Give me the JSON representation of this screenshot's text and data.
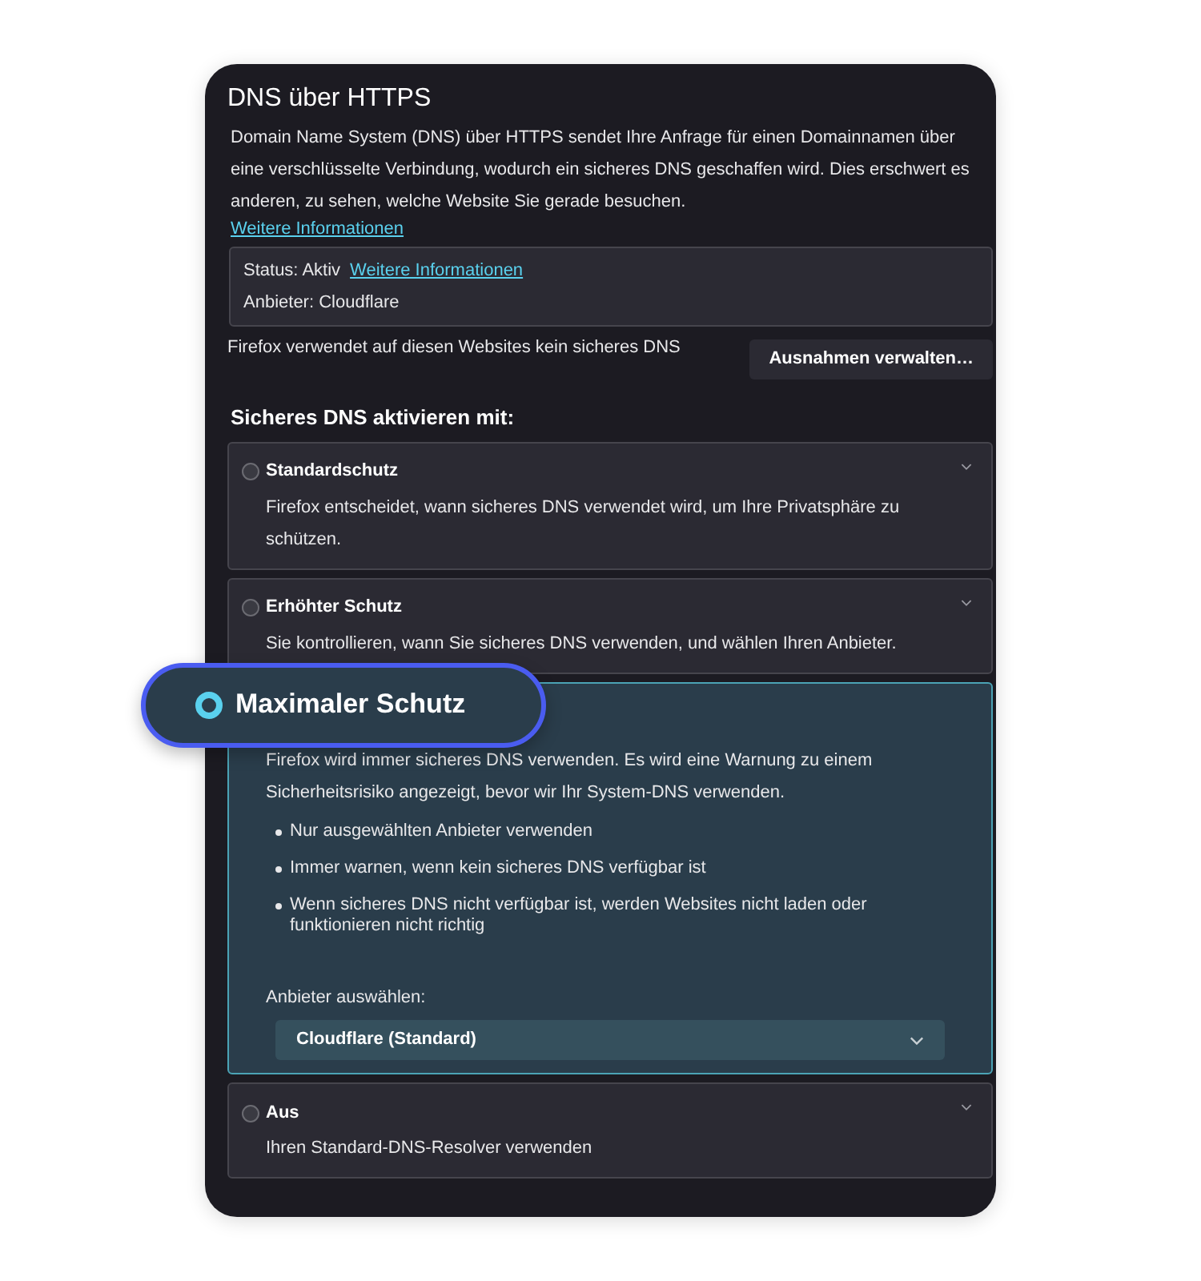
{
  "title": "DNS über HTTPS",
  "description": "Domain Name System (DNS) über HTTPS sendet Ihre Anfrage für einen Domainnamen über eine verschlüsselte Verbindung, wodurch ein sicheres DNS geschaffen wird. Dies erschwert es anderen, zu sehen, welche Website Sie gerade besuchen.",
  "learn_more": "Weitere Informationen",
  "status": {
    "status": "Status: Aktiv",
    "link": "Weitere Informationen",
    "provider": "Anbieter: Cloudflare"
  },
  "exceptions": {
    "text": "Firefox verwendet auf diesen Websites kein sicheres DNS",
    "button": "Ausnahmen verwalten…"
  },
  "section_title": "Sicheres DNS aktivieren mit:",
  "options": [
    {
      "label": "Standardschutz",
      "description": "Firefox entscheidet, wann sicheres DNS verwendet wird, um Ihre Privatsphäre zu schützen.",
      "selected": false,
      "expanded": false
    },
    {
      "label": "Erhöhter Schutz",
      "description": "Sie kontrollieren, wann Sie sicheres DNS verwenden, und wählen Ihren Anbieter.",
      "selected": false,
      "expanded": false
    },
    {
      "label": "Maximaler Schutz",
      "description": "Firefox wird immer sicheres DNS verwenden. Es wird eine Warnung zu einem Sicherheitsrisiko angezeigt, bevor wir Ihr System-DNS verwenden.",
      "selected": true,
      "expanded": true,
      "bullets": [
        "Nur ausgewählten Anbieter verwenden",
        "Immer warnen, wenn kein sicheres DNS verfügbar ist",
        "Wenn sicheres DNS nicht verfügbar ist, werden Websites nicht laden oder funktionieren nicht richtig"
      ],
      "provider_label": "Anbieter auswählen:",
      "provider_value": "Cloudflare (Standard)"
    },
    {
      "label": "Aus",
      "description": "Ihren Standard-DNS-Resolver verwenden",
      "selected": false,
      "expanded": false
    }
  ]
}
